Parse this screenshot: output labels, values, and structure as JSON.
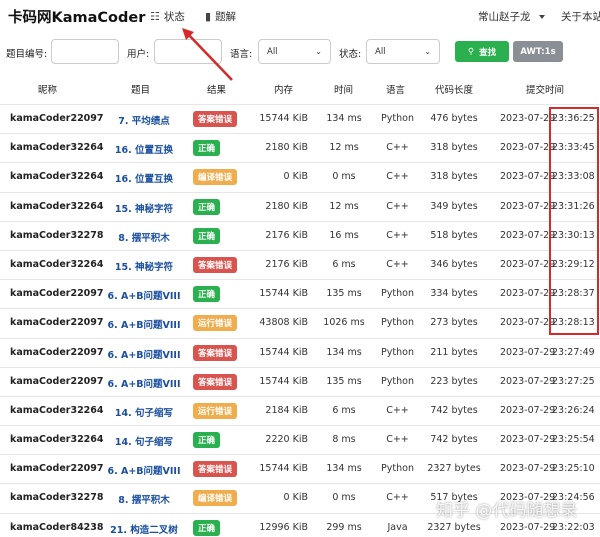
{
  "nav": {
    "brand": "卡码网KamaCoder",
    "status_label": "状态",
    "solutions_label": "题解",
    "user_label": "常山赵子龙",
    "about_label": "关于本站"
  },
  "filters": {
    "problem_id_label": "题目编号:",
    "user_label": "用户:",
    "language_label": "语言:",
    "language_value": "All",
    "status_label": "状态:",
    "status_value": "All",
    "search_label": "查找",
    "awt_label": "AWT:1s"
  },
  "table": {
    "headers": {
      "user": "昵称",
      "problem": "题目",
      "result": "结果",
      "memory": "内存",
      "time": "时间",
      "language": "语言",
      "length": "代码长度",
      "submitted": "提交时间"
    },
    "rows": [
      {
        "user": "kamaCoder22097",
        "problem": "7. 平均绩点",
        "result": "答案错误",
        "result_color": "#d9534f",
        "memory": "15744 KiB",
        "time": "134 ms",
        "language": "Python",
        "length": "476 bytes",
        "date": "2023-07-29",
        "hms": "23:36:25"
      },
      {
        "user": "kamaCoder32264",
        "problem": "16. 位置互换",
        "result": "正确",
        "result_color": "#2ab04f",
        "memory": "2180 KiB",
        "time": "12 ms",
        "language": "C++",
        "length": "318 bytes",
        "date": "2023-07-29",
        "hms": "23:33:45"
      },
      {
        "user": "kamaCoder32264",
        "problem": "16. 位置互换",
        "result": "编译错误",
        "result_color": "#f0ad4e",
        "memory": "0 KiB",
        "time": "0 ms",
        "language": "C++",
        "length": "318 bytes",
        "date": "2023-07-29",
        "hms": "23:33:08"
      },
      {
        "user": "kamaCoder32264",
        "problem": "15. 神秘字符",
        "result": "正确",
        "result_color": "#2ab04f",
        "memory": "2180 KiB",
        "time": "12 ms",
        "language": "C++",
        "length": "349 bytes",
        "date": "2023-07-29",
        "hms": "23:31:26"
      },
      {
        "user": "kamaCoder32278",
        "problem": "8. 摆平积木",
        "result": "正确",
        "result_color": "#2ab04f",
        "memory": "2176 KiB",
        "time": "16 ms",
        "language": "C++",
        "length": "518 bytes",
        "date": "2023-07-29",
        "hms": "23:30:13"
      },
      {
        "user": "kamaCoder32264",
        "problem": "15. 神秘字符",
        "result": "答案错误",
        "result_color": "#d9534f",
        "memory": "2176 KiB",
        "time": "6 ms",
        "language": "C++",
        "length": "346 bytes",
        "date": "2023-07-29",
        "hms": "23:29:12"
      },
      {
        "user": "kamaCoder22097",
        "problem": "6. A+B问题VIII",
        "result": "正确",
        "result_color": "#2ab04f",
        "memory": "15744 KiB",
        "time": "135 ms",
        "language": "Python",
        "length": "334 bytes",
        "date": "2023-07-29",
        "hms": "23:28:37"
      },
      {
        "user": "kamaCoder22097",
        "problem": "6. A+B问题VIII",
        "result": "运行错误",
        "result_color": "#f0ad4e",
        "memory": "43808 KiB",
        "time": "1026 ms",
        "language": "Python",
        "length": "273 bytes",
        "date": "2023-07-29",
        "hms": "23:28:13"
      },
      {
        "user": "kamaCoder22097",
        "problem": "6. A+B问题VIII",
        "result": "答案错误",
        "result_color": "#d9534f",
        "memory": "15744 KiB",
        "time": "134 ms",
        "language": "Python",
        "length": "211 bytes",
        "date": "2023-07-29",
        "hms": "23:27:49"
      },
      {
        "user": "kamaCoder22097",
        "problem": "6. A+B问题VIII",
        "result": "答案错误",
        "result_color": "#d9534f",
        "memory": "15744 KiB",
        "time": "135 ms",
        "language": "Python",
        "length": "223 bytes",
        "date": "2023-07-29",
        "hms": "23:27:25"
      },
      {
        "user": "kamaCoder32264",
        "problem": "14. 句子缩写",
        "result": "运行错误",
        "result_color": "#f0ad4e",
        "memory": "2184 KiB",
        "time": "6 ms",
        "language": "C++",
        "length": "742 bytes",
        "date": "2023-07-29",
        "hms": "23:26:24"
      },
      {
        "user": "kamaCoder32264",
        "problem": "14. 句子缩写",
        "result": "正确",
        "result_color": "#2ab04f",
        "memory": "2220 KiB",
        "time": "8 ms",
        "language": "C++",
        "length": "742 bytes",
        "date": "2023-07-29",
        "hms": "23:25:54"
      },
      {
        "user": "kamaCoder22097",
        "problem": "6. A+B问题VIII",
        "result": "答案错误",
        "result_color": "#d9534f",
        "memory": "15744 KiB",
        "time": "134 ms",
        "language": "Python",
        "length": "2327 bytes",
        "date": "2023-07-29",
        "hms": "23:25:10"
      },
      {
        "user": "kamaCoder32278",
        "problem": "8. 摆平积木",
        "result": "编译错误",
        "result_color": "#f0ad4e",
        "memory": "0 KiB",
        "time": "0 ms",
        "language": "C++",
        "length": "517 bytes",
        "date": "2023-07-29",
        "hms": "23:24:56"
      },
      {
        "user": "kamaCoder84238",
        "problem": "21. 构造二叉树",
        "result": "正确",
        "result_color": "#2ab04f",
        "memory": "12996 KiB",
        "time": "299 ms",
        "language": "Java",
        "length": "2327 bytes",
        "date": "2023-07-29",
        "hms": "23:22:03"
      }
    ]
  },
  "annotation": {
    "highlight_color": "#d42a2a"
  },
  "watermark": "知乎 @代码随想录"
}
